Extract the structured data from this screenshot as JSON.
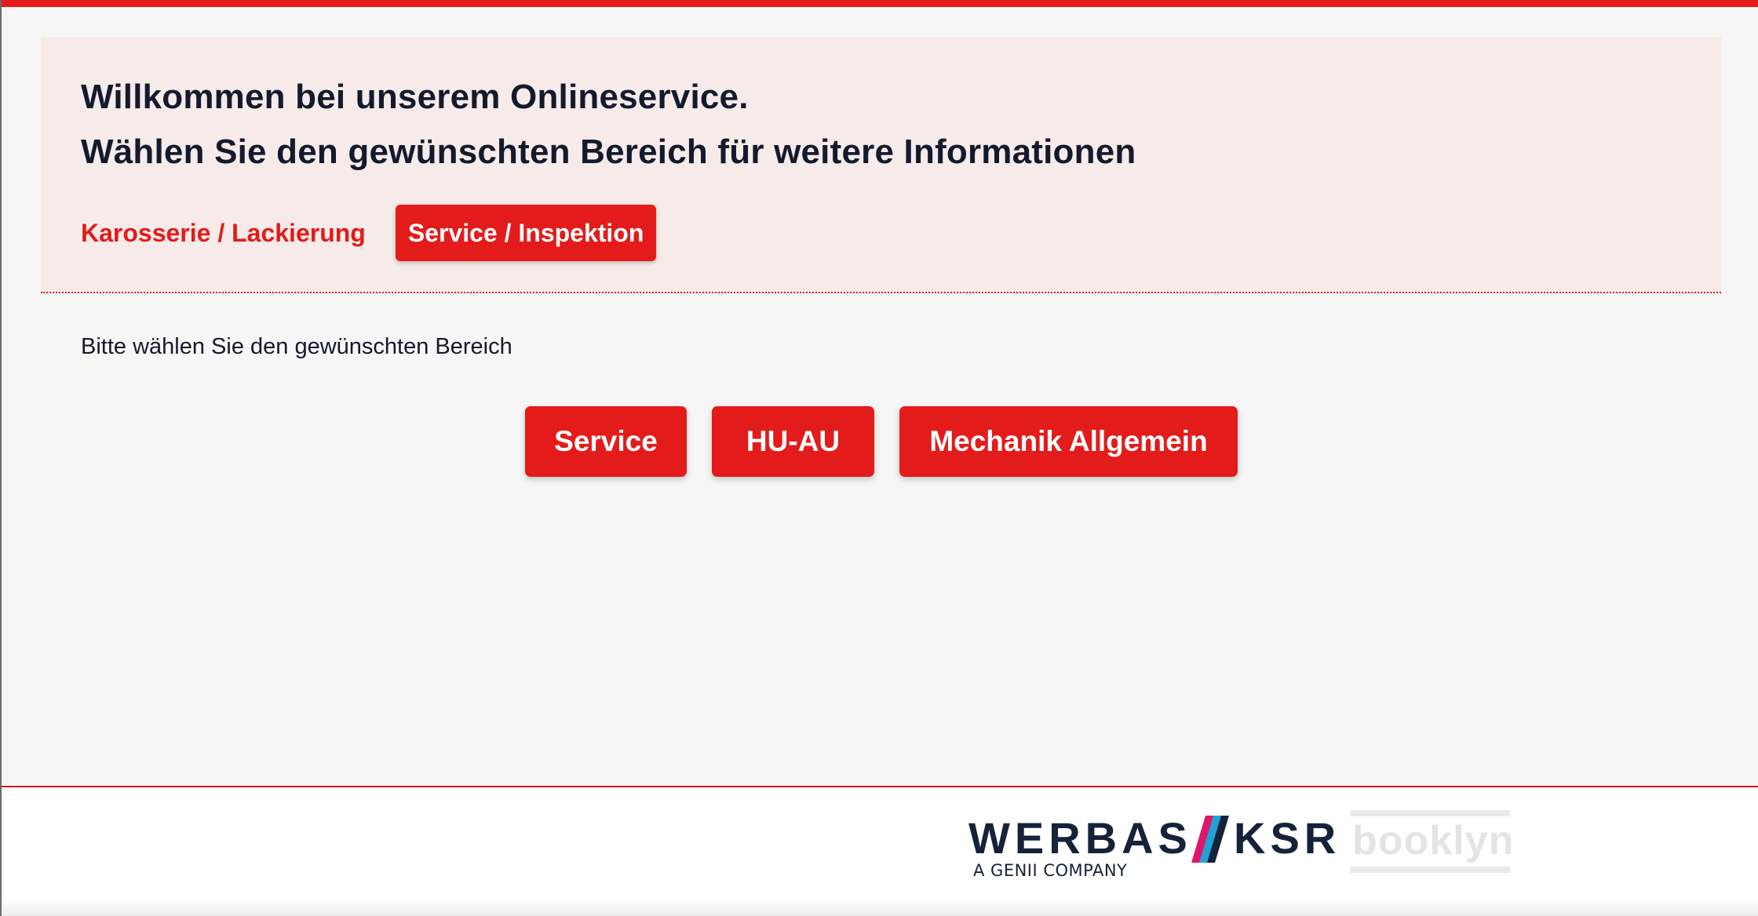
{
  "welcome": {
    "line1": "Willkommen bei unserem Onlineservice.",
    "line2": "Wählen Sie den gewünschten Bereich für weitere Informationen"
  },
  "tabs": [
    {
      "label": "Karosserie / Lackierung",
      "active": false
    },
    {
      "label": "Service / Inspektion",
      "active": true
    }
  ],
  "instruction": "Bitte wählen Sie den gewünschten Bereich",
  "choices": [
    {
      "label": "Service"
    },
    {
      "label": "HU-AU"
    },
    {
      "label": "Mechanik Allgemein"
    }
  ],
  "footer": {
    "werbas_logo": {
      "word1": "WERBAS",
      "word2": "KSR",
      "tagline": "A GENII COMPANY"
    },
    "booklyn_logo": {
      "word": "booklyn"
    }
  },
  "colors": {
    "accent": "#e31b1b",
    "text_dark": "#141a2e",
    "panel_bg": "#f6ebe9",
    "page_bg": "#f6f6f6",
    "logo_navy": "#15223a",
    "logo_blue": "#1fa3d6",
    "logo_pink": "#e0156b"
  }
}
